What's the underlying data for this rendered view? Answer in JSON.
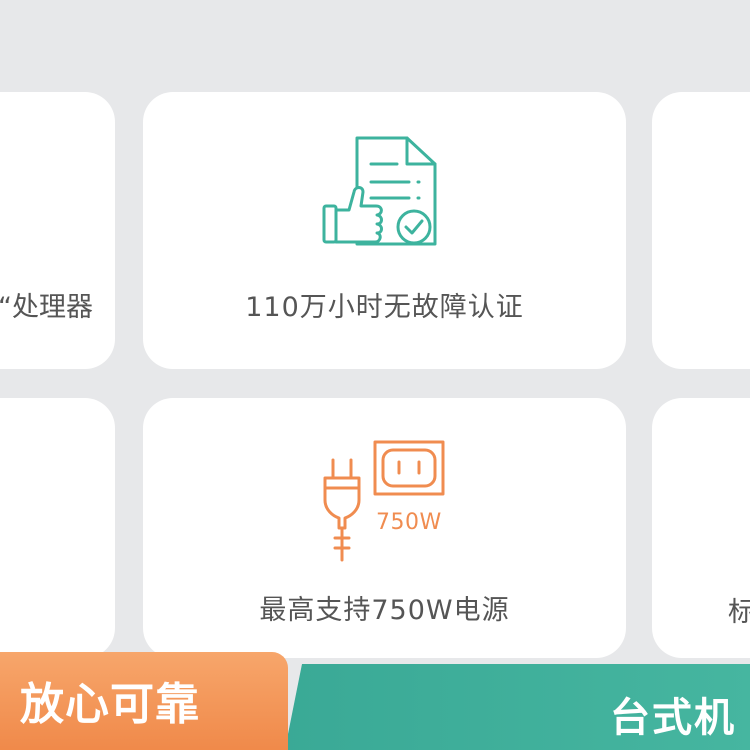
{
  "cards": {
    "top_left_label": "“处理器",
    "top_center_label": "110万小时无故障认证",
    "bottom_center_label": "最高支持750W电源",
    "bottom_right_label": "标",
    "power_rating": "750W"
  },
  "tabs": {
    "left": "放心可靠",
    "right": "台式机"
  },
  "icons": {
    "certificate": "thumbs-up-certificate-icon",
    "power": "power-plug-outlet-icon"
  },
  "colors": {
    "teal": "#3db39e",
    "orange": "#f08c50",
    "card": "#ffffff",
    "background": "#e7e8ea"
  }
}
